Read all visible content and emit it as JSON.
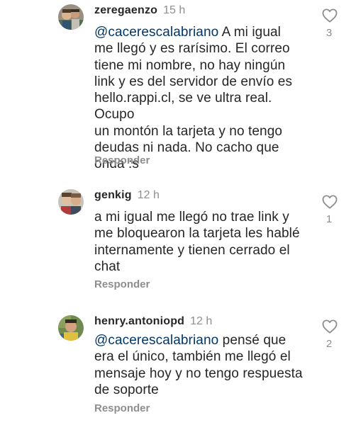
{
  "comments": [
    {
      "username": "zeregaenzo",
      "time": "15 h",
      "mention": "@cacerescalabriano",
      "lines": [
        " A mi igual",
        "me llegó y es rarísimo. El correo",
        "tiene mi nombre, no hay ningún",
        "link y es del servidor de envío es",
        "hello.rappi.cl, se ve ultra real. Ocupo",
        "un montón la tarjeta y no tengo",
        "deudas ni nada. No cacho que",
        "onda :s"
      ],
      "reply_label": "Responder",
      "likes": "3"
    },
    {
      "username": "genkig",
      "time": "12 h",
      "mention": "",
      "lines": [
        "a mi igual me llegó no trae link y",
        "me bloquearon la tarjeta les hablé",
        "internamente y tienen cerrado el",
        "chat"
      ],
      "reply_label": "Responder",
      "likes": "1"
    },
    {
      "username": "henry.antoniopd",
      "time": "12 h",
      "mention": "@cacerescalabriano",
      "lines": [
        " pensé que",
        "era el único, también me llegó el",
        "mensaje hoy y no tengo respuesta",
        "de soporte"
      ],
      "reply_label": "Responder",
      "likes": "2"
    }
  ],
  "colors": {
    "text": "#262626",
    "muted": "#8e8e8e",
    "mention": "#00376b"
  },
  "icons": {
    "like": "heart-outline-icon"
  }
}
